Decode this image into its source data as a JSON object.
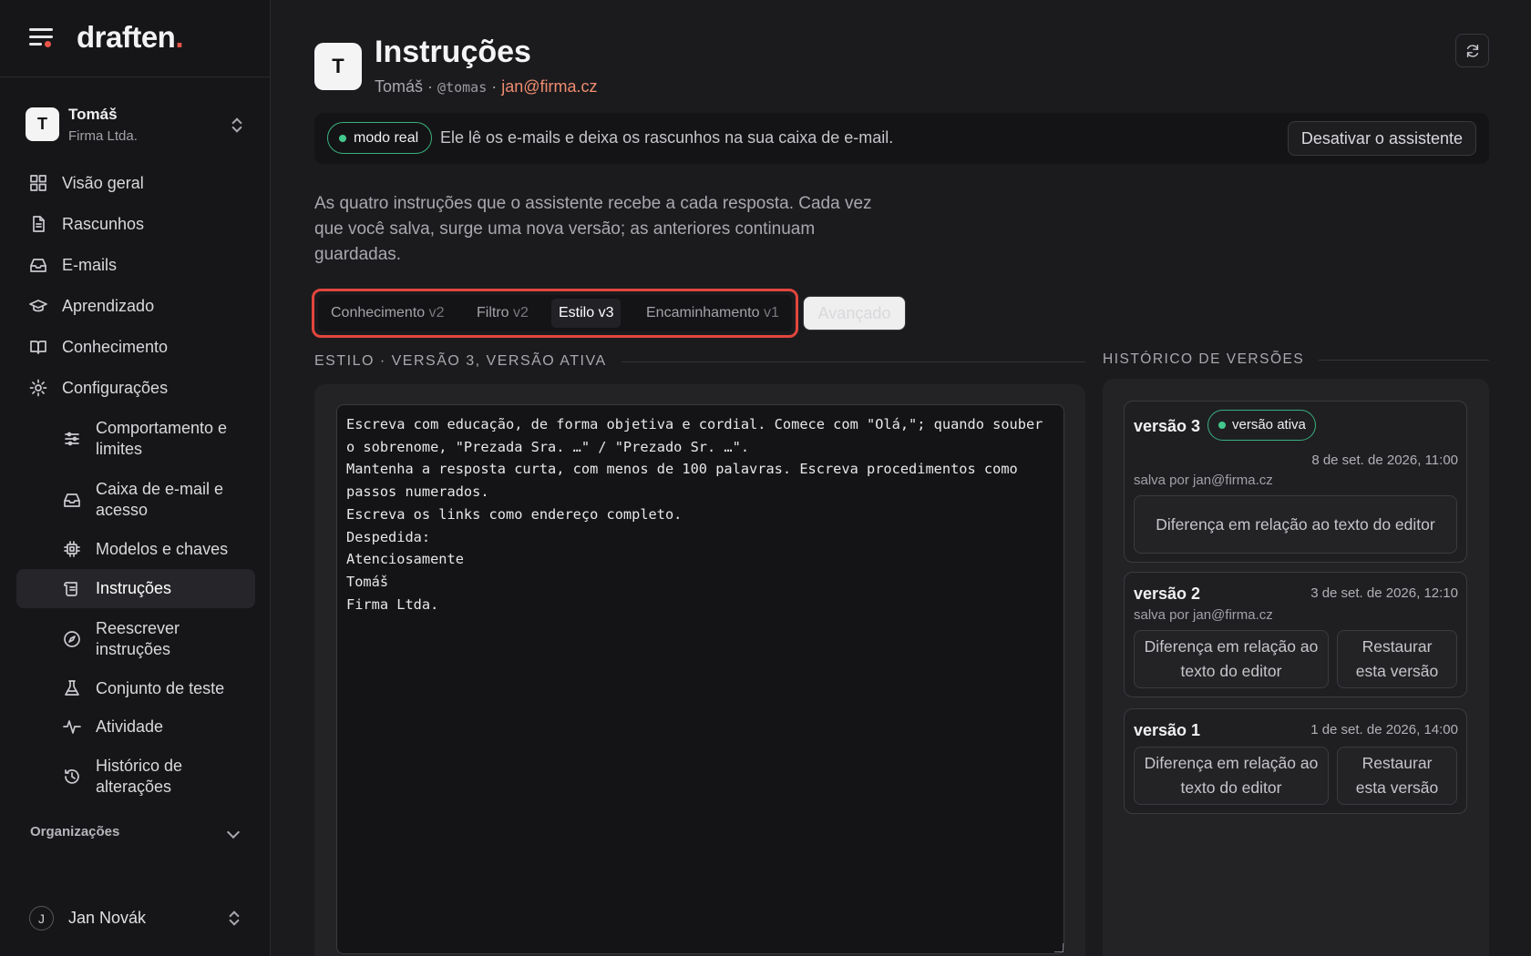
{
  "app": {
    "logo_text": "draften",
    "logo_dot": "."
  },
  "account": {
    "avatar_letter": "T",
    "name": "Tomáš",
    "org": "Firma Ltda."
  },
  "nav": {
    "overview": "Visão geral",
    "drafts": "Rascunhos",
    "emails": "E-mails",
    "learned": "Aprendizado",
    "knowledge": "Conhecimento",
    "settings": "Configurações",
    "sub": {
      "behavior": "Comportamento e limites",
      "mailbox": "Caixa de e-mail e acesso",
      "models": "Modelos e chaves",
      "instructions": "Instruções",
      "rewrite": "Reescrever instruções",
      "testset": "Conjunto de teste",
      "activity": "Atividade",
      "changes": "Histórico de alterações"
    },
    "organizations": "Organizações"
  },
  "user": {
    "avatar_letter": "J",
    "name": "Jan Novák"
  },
  "page": {
    "avatar_letter": "T",
    "title": "Instruções",
    "sub_name": "Tomáš",
    "sub_sep1": "·",
    "sub_handle": "@tomas",
    "sub_sep2": "·",
    "sub_email": "jan@firma.cz"
  },
  "banner": {
    "mode": "modo real",
    "text": "Ele lê os e-mails e deixa os rascunhos na sua caixa de e-mail.",
    "disable_button": "Desativar o assistente"
  },
  "description": "As quatro instruções que o assistente recebe a cada resposta. Cada vez que você salva, surge uma nova versão; as anteriores continuam guardadas.",
  "tabs": [
    {
      "label": "Conhecimento",
      "version": "v2"
    },
    {
      "label": "Filtro",
      "version": "v2"
    },
    {
      "label": "Estilo",
      "version": "v3"
    },
    {
      "label": "Encaminhamento",
      "version": "v1"
    }
  ],
  "advanced_button": "Avançado",
  "editor": {
    "heading": "ESTILO · VERSÃO 3, VERSÃO ATIVA",
    "content": "Escreva com educação, de forma objetiva e cordial. Comece com \"Olá,\"; quando souber o sobrenome, \"Prezada Sra. …\" / \"Prezado Sr. …\".\nMantenha a resposta curta, com menos de 100 palavras. Escreva procedimentos como passos numerados.\nEscreva os links como endereço completo.\nDespedida:\nAtenciosamente\nTomáš\nFirma Ltda."
  },
  "history": {
    "heading": "HISTÓRICO DE VERSÕES",
    "versions": [
      {
        "title": "versão 3",
        "badge": "versão ativa",
        "date": "8 de set. de 2026, 11:00",
        "saved_by": "salva por jan@firma.cz",
        "diff_button": "Diferença em relação ao texto do editor"
      },
      {
        "title": "versão 2",
        "date": "3 de set. de 2026, 12:10",
        "saved_by": "salva por jan@firma.cz",
        "diff_button": "Diferença em relação ao texto do editor",
        "restore_button": "Restaurar esta versão"
      },
      {
        "title": "versão 1",
        "date": "1 de set. de 2026, 14:00",
        "diff_button": "Diferença em relação ao texto do editor",
        "restore_button": "Restaurar esta versão"
      }
    ]
  }
}
